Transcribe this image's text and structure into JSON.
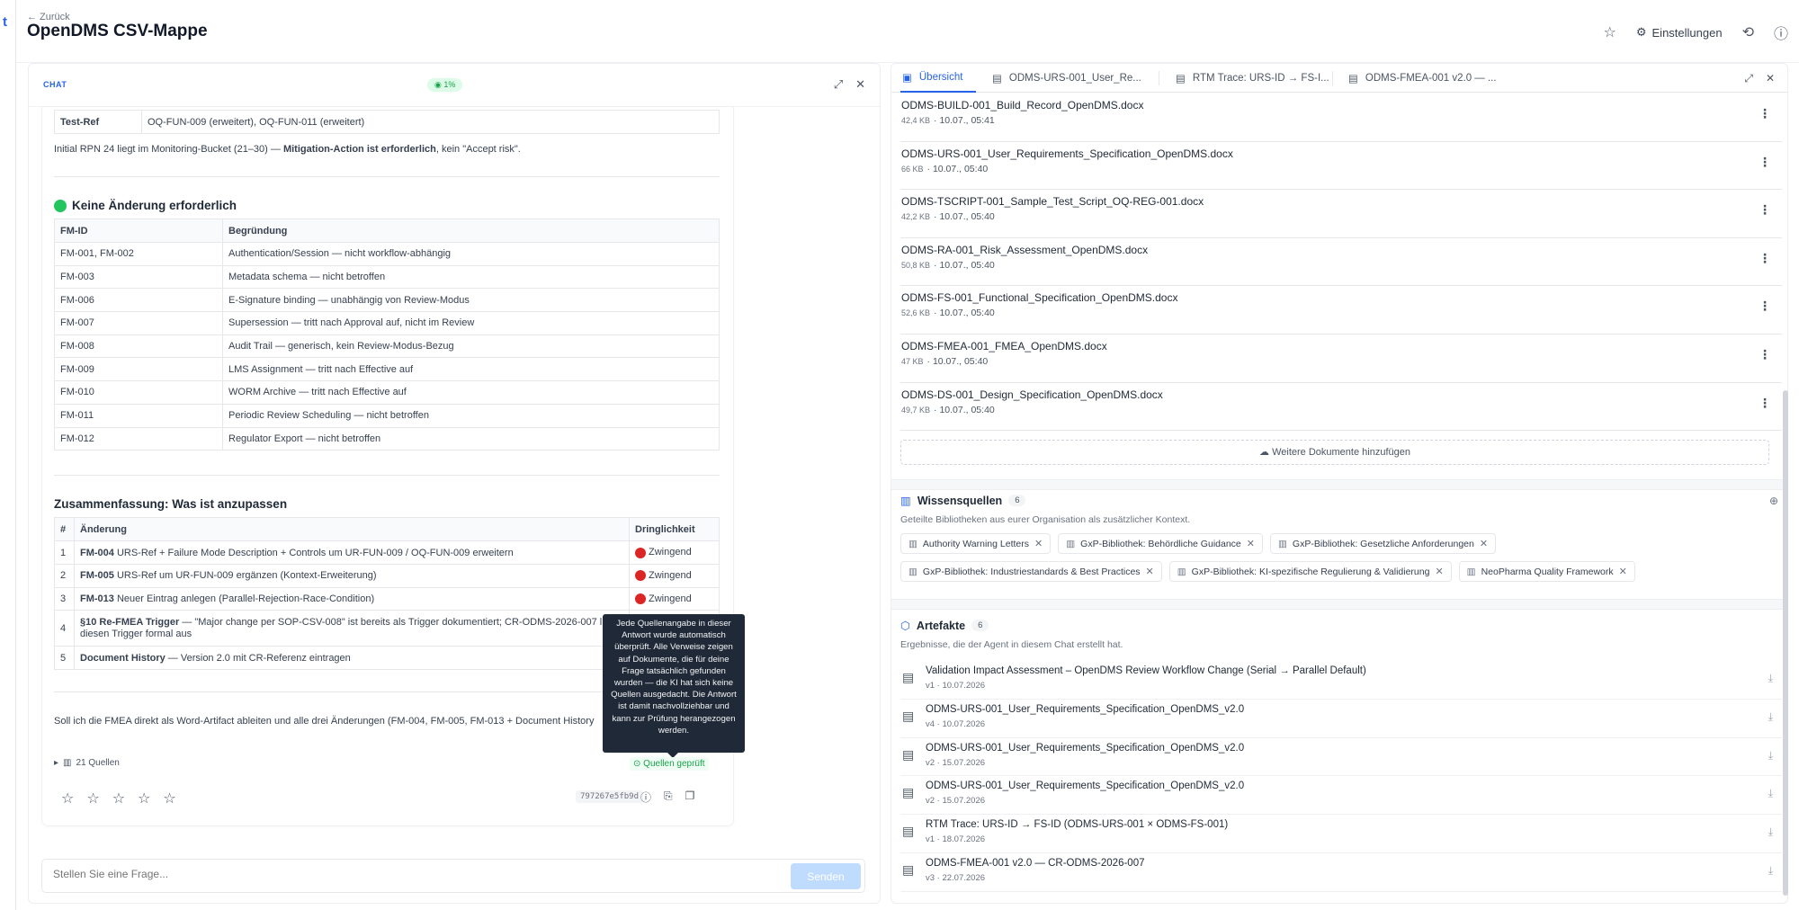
{
  "app": {
    "logo": "t",
    "back_label": "← Zurück",
    "title": "OpenDMS CSV-Mappe",
    "settings_label": "Einstellungen"
  },
  "chat": {
    "label": "CHAT",
    "badge": "1%",
    "test_ref": {
      "key": "Test-Ref",
      "value": "OQ-FUN-009 (erweitert), OQ-FUN-011 (erweitert)"
    },
    "rpn_text_pre": "Initial RPN 24 liegt im Monitoring-Bucket (21–30) — ",
    "rpn_text_bold": "Mitigation-Action ist erforderlich",
    "rpn_text_post": ", kein \"Accept risk\".",
    "section1_title": "Keine Änderung erforderlich",
    "table1_headers": [
      "FM-ID",
      "Begründung"
    ],
    "table1_rows": [
      [
        "FM-001, FM-002",
        "Authentication/Session — nicht workflow-abhängig"
      ],
      [
        "FM-003",
        "Metadata schema — nicht betroffen"
      ],
      [
        "FM-006",
        "E-Signature binding — unabhängig von Review-Modus"
      ],
      [
        "FM-007",
        "Supersession — tritt nach Approval auf, nicht im Review"
      ],
      [
        "FM-008",
        "Audit Trail — generisch, kein Review-Modus-Bezug"
      ],
      [
        "FM-009",
        "LMS Assignment — tritt nach Effective auf"
      ],
      [
        "FM-010",
        "WORM Archive — tritt nach Effective auf"
      ],
      [
        "FM-011",
        "Periodic Review Scheduling — nicht betroffen"
      ],
      [
        "FM-012",
        "Regulator Export — nicht betroffen"
      ]
    ],
    "section2_title": "Zusammenfassung: Was ist anzupassen",
    "table2_headers": [
      "#",
      "Änderung",
      "Dringlichkeit"
    ],
    "table2_rows": [
      {
        "n": "1",
        "bold": "FM-004",
        "text": " URS-Ref + Failure Mode Description + Controls um UR-FUN-009 / OQ-FUN-009 erweitern",
        "urg": "Zwingend"
      },
      {
        "n": "2",
        "bold": "FM-005",
        "text": " URS-Ref um UR-FUN-009 ergänzen (Kontext-Erweiterung)",
        "urg": "Zwingend"
      },
      {
        "n": "3",
        "bold": "FM-013",
        "text": " Neuer Eintrag anlegen (Parallel-Rejection-Race-Condition)",
        "urg": "Zwingend"
      },
      {
        "n": "4",
        "bold": "§10 Re-FMEA Trigger",
        "text": " — \"Major change per SOP-CSV-008\" ist bereits als Trigger dokumentiert; CR-ODMS-2026-007 l… diesen Trigger formal aus",
        "urg": ""
      },
      {
        "n": "5",
        "bold": "Document History",
        "text": " — Version 2.0 mit CR-Referenz eintragen",
        "urg": ""
      }
    ],
    "question": "Soll ich die FMEA direkt als Word-Artifact ableiten und alle drei Änderungen (FM-004, FM-005, FM-013 + Document History",
    "tooltip": "Jede Quellenangabe in dieser Antwort wurde automatisch überprüft. Alle Verweise zeigen auf Dokumente, die für deine Frage tatsächlich gefunden wurden — die KI hat sich keine Quellen ausgedacht. Die Antwort ist damit nachvollziehbar und kann zur Prüfung herangezogen werden.",
    "sources_label": "21 Quellen",
    "checked_label": "Quellen geprüft",
    "hash": "797267e5fb9d",
    "input_placeholder": "Stellen Sie eine Frage...",
    "send_label": "Senden"
  },
  "right": {
    "tabs": [
      "Übersicht",
      "ODMS-URS-001_User_Re...",
      "RTM Trace: URS-ID → FS-I...",
      "ODMS-FMEA-001 v2.0 — ..."
    ],
    "documents": [
      {
        "name": "ODMS-BUILD-001_Build_Record_OpenDMS.docx",
        "size": "42,4 KB",
        "date": "· 10.07., 05:41"
      },
      {
        "name": "ODMS-URS-001_User_Requirements_Specification_OpenDMS.docx",
        "size": "66 KB",
        "date": "· 10.07., 05:40"
      },
      {
        "name": "ODMS-TSCRIPT-001_Sample_Test_Script_OQ-REG-001.docx",
        "size": "42,2 KB",
        "date": "· 10.07., 05:40"
      },
      {
        "name": "ODMS-RA-001_Risk_Assessment_OpenDMS.docx",
        "size": "50,8 KB",
        "date": "· 10.07., 05:40"
      },
      {
        "name": "ODMS-FS-001_Functional_Specification_OpenDMS.docx",
        "size": "52,6 KB",
        "date": "· 10.07., 05:40"
      },
      {
        "name": "ODMS-FMEA-001_FMEA_OpenDMS.docx",
        "size": "47 KB",
        "date": "· 10.07., 05:40"
      },
      {
        "name": "ODMS-DS-001_Design_Specification_OpenDMS.docx",
        "size": "49,7 KB",
        "date": "· 10.07., 05:40"
      }
    ],
    "add_docs_label": "Weitere Dokumente hinzufügen",
    "knowledge_title": "Wissensquellen",
    "knowledge_count": "6",
    "knowledge_sub": "Geteilte Bibliotheken aus eurer Organisation als zusätzlicher Kontext.",
    "chips": [
      "Authority Warning Letters",
      "GxP-Bibliothek: Behördliche Guidance",
      "GxP-Bibliothek: Gesetzliche Anforderungen",
      "GxP-Bibliothek: Industriestandards & Best Practices",
      "GxP-Bibliothek: KI-spezifische Regulierung & Validierung",
      "NeoPharma Quality Framework"
    ],
    "artifacts_title": "Artefakte",
    "artifacts_count": "6",
    "artifacts_sub": "Ergebnisse, die der Agent in diesem Chat erstellt hat.",
    "artifacts": [
      {
        "name": "Validation Impact Assessment – OpenDMS Review Workflow Change (Serial → Parallel Default)",
        "meta": "v1 · 10.07.2026"
      },
      {
        "name": "ODMS-URS-001_User_Requirements_Specification_OpenDMS_v2.0",
        "meta": "v4 · 10.07.2026"
      },
      {
        "name": "ODMS-URS-001_User_Requirements_Specification_OpenDMS_v2.0",
        "meta": "v2 · 15.07.2026"
      },
      {
        "name": "ODMS-URS-001_User_Requirements_Specification_OpenDMS_v2.0",
        "meta": "v2 · 15.07.2026"
      },
      {
        "name": "RTM Trace: URS-ID → FS-ID (ODMS-URS-001 × ODMS-FS-001)",
        "meta": "v1 · 18.07.2026"
      },
      {
        "name": "ODMS-FMEA-001 v2.0 — CR-ODMS-2026-007",
        "meta": "v3 · 22.07.2026"
      }
    ]
  }
}
